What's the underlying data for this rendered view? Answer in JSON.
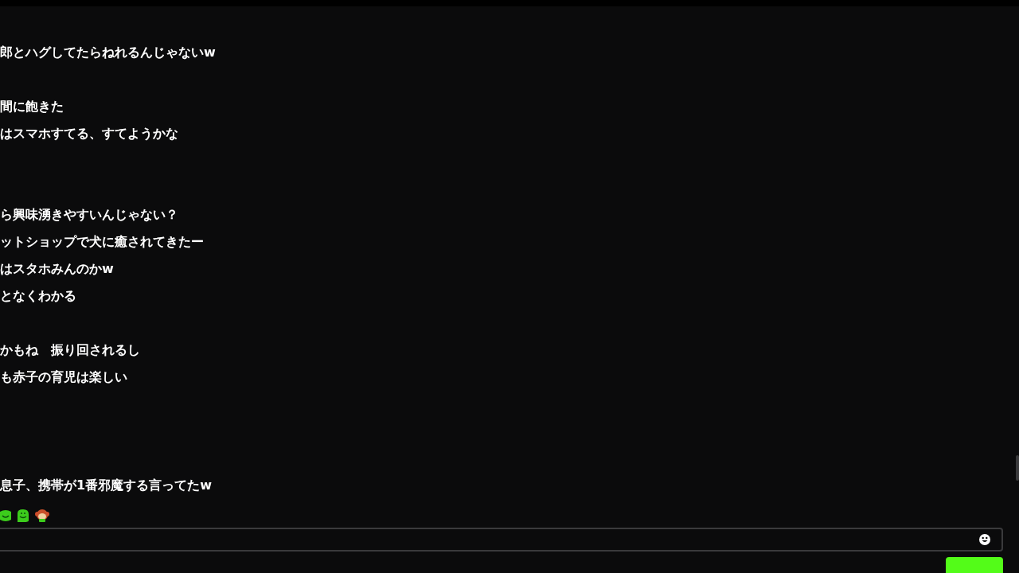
{
  "messages": [
    {
      "text": "郎とハグしてたらねれるんじゃないw"
    },
    {
      "text": "間に飽きた"
    },
    {
      "text": "はスマホすてる、すてようかな"
    },
    {
      "text": "ら興味湧きやすいんじゃない？"
    },
    {
      "text": "ットショップで犬に癒されてきたー"
    },
    {
      "text": "はスタホみんのかw"
    },
    {
      "text": "となくわかる"
    },
    {
      "text": "かもね　振り回されるし"
    },
    {
      "text": "も赤子の育児は楽しい"
    },
    {
      "text": "息子、携帯が1番邪魔する言ってたw"
    }
  ],
  "emotes": [
    {
      "kind": "frog"
    },
    {
      "kind": "blob"
    },
    {
      "kind": "monkey"
    }
  ]
}
